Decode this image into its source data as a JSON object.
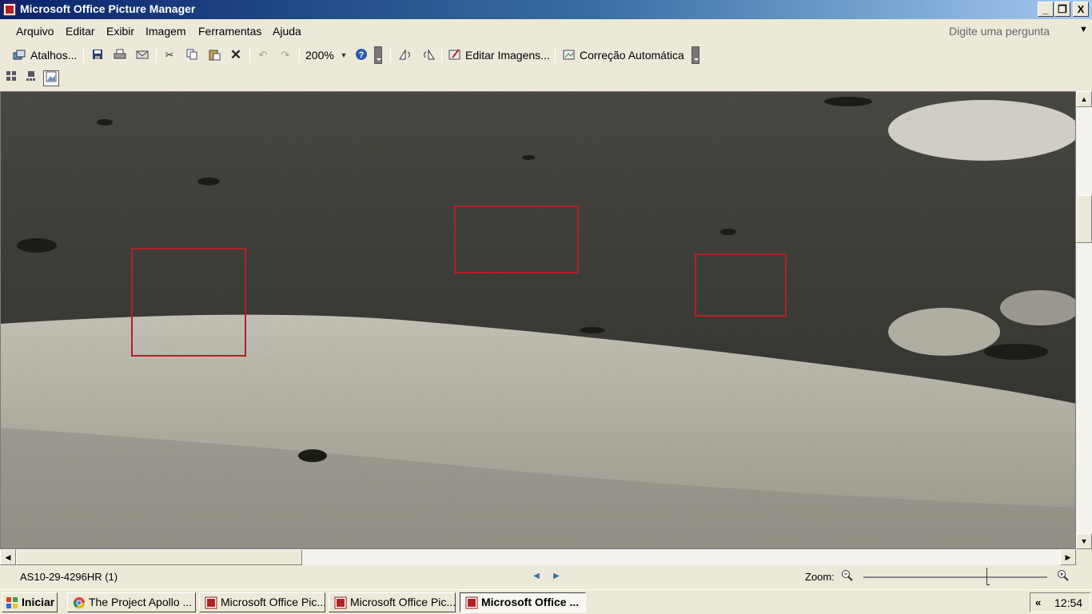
{
  "window": {
    "title": "Microsoft Office Picture Manager"
  },
  "title_buttons": {
    "minimize": "_",
    "restore": "❐",
    "close": "X"
  },
  "menu": {
    "items": [
      {
        "label": "Arquivo"
      },
      {
        "label": "Editar"
      },
      {
        "label": "Exibir"
      },
      {
        "label": "Imagem"
      },
      {
        "label": "Ferramentas"
      },
      {
        "label": "Ajuda"
      }
    ],
    "help_placeholder": "Digite uma pergunta"
  },
  "toolbar": {
    "shortcuts_label": "Atalhos...",
    "zoom_value": "200%",
    "edit_images_label": "Editar Imagens...",
    "auto_correct_label": "Correção Automática",
    "icons": [
      "shortcuts-icon",
      "save-icon",
      "print-icon",
      "email-icon",
      "cut-icon",
      "copy-icon",
      "paste-icon",
      "delete-icon",
      "undo-icon",
      "redo-icon",
      "help-icon",
      "rotate-left-icon",
      "rotate-right-icon",
      "edit-images-icon",
      "auto-correct-icon"
    ]
  },
  "view_buttons": [
    "thumbnail-view-icon",
    "filmstrip-view-icon",
    "single-picture-view-icon"
  ],
  "viewer": {
    "image_description_colors": {
      "dark": "#3e3e39",
      "light": "#b5b3a6",
      "highlight": "#d8d6cc",
      "annotation": "#b22222"
    }
  },
  "status": {
    "file_name": "AS10-29-4296HR (1)",
    "zoom_label": "Zoom:",
    "zoom_level": 0.67
  },
  "taskbar": {
    "start_label": "Iniciar",
    "tasks": [
      {
        "label": "The Project Apollo ..."
      },
      {
        "label": "Microsoft Office Pic..."
      },
      {
        "label": "Microsoft Office Pic..."
      },
      {
        "label": "Microsoft Office ..."
      }
    ],
    "tray_expand": "«",
    "clock": "12:54"
  }
}
